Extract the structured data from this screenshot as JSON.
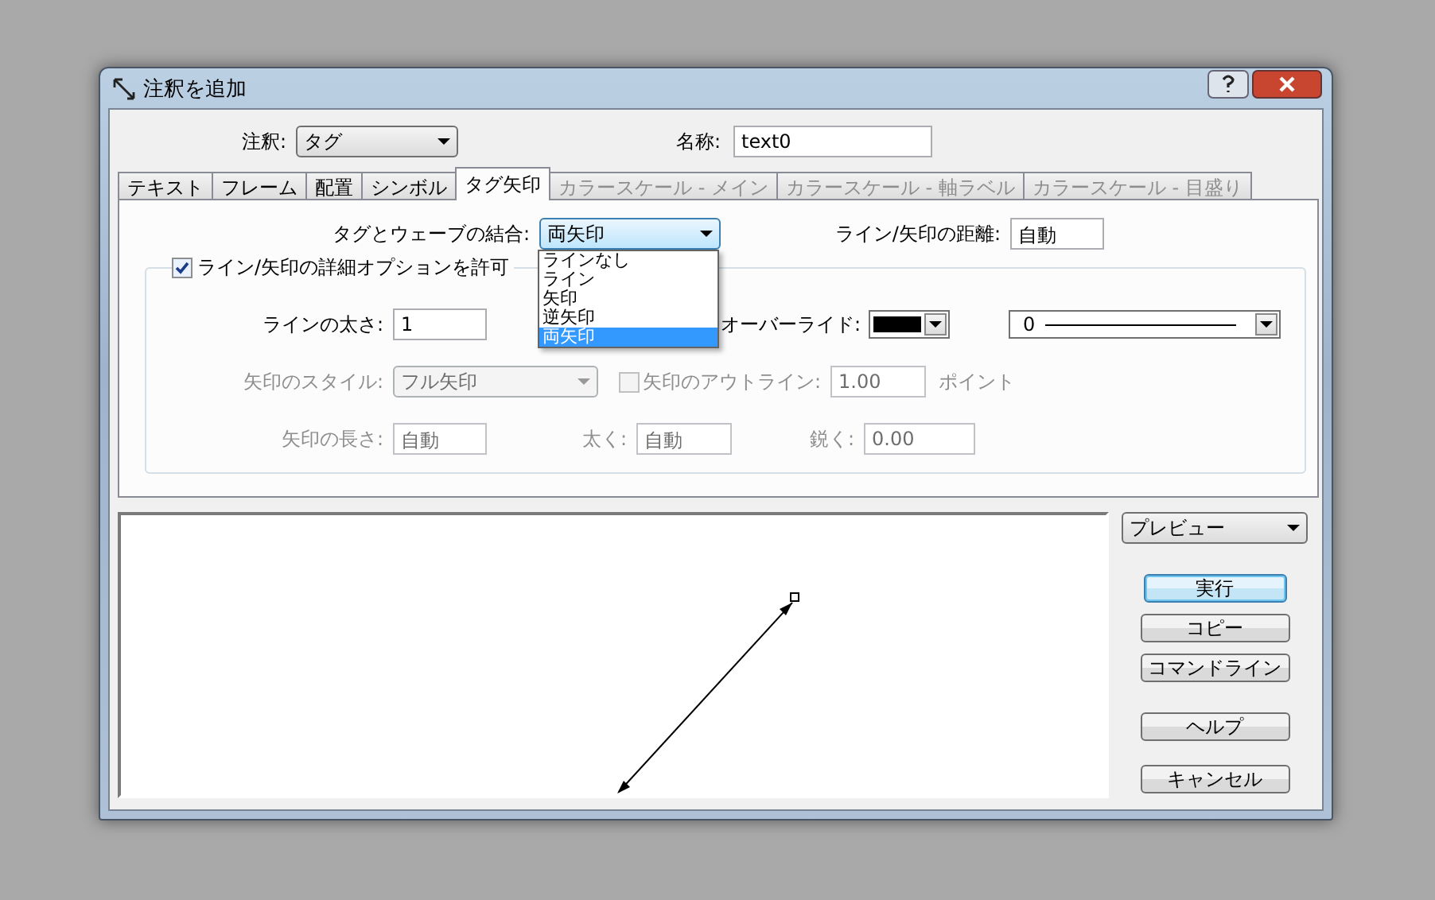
{
  "window": {
    "title": "注釈を追加"
  },
  "annotation": {
    "label": "注釈:",
    "value": "タグ"
  },
  "name": {
    "label": "名称:",
    "value": "text0"
  },
  "tabs": [
    {
      "label": "テキスト",
      "selected": false,
      "disabled": false
    },
    {
      "label": "フレーム",
      "selected": false,
      "disabled": false
    },
    {
      "label": "配置",
      "selected": false,
      "disabled": false
    },
    {
      "label": "シンボル",
      "selected": false,
      "disabled": false
    },
    {
      "label": "タグ矢印",
      "selected": true,
      "disabled": false
    },
    {
      "label": "カラースケール - メイン",
      "selected": false,
      "disabled": true
    },
    {
      "label": "カラースケール - 軸ラベル",
      "selected": false,
      "disabled": true
    },
    {
      "label": "カラースケール - 目盛り",
      "selected": false,
      "disabled": true
    }
  ],
  "join": {
    "label": "タグとウェーブの結合:",
    "value": "両矢印",
    "expanded": true,
    "options": [
      {
        "label": "ラインなし",
        "selected": false
      },
      {
        "label": "ライン",
        "selected": false
      },
      {
        "label": "矢印",
        "selected": false
      },
      {
        "label": "逆矢印",
        "selected": false
      },
      {
        "label": "両矢印",
        "selected": true
      }
    ]
  },
  "distance": {
    "label": "ライン/矢印の距離:",
    "value": "自動"
  },
  "advanced": {
    "label": "ライン/矢印の詳細オプションを許可",
    "checked": true
  },
  "line_width": {
    "label": "ラインの太さ:",
    "value": "1"
  },
  "override": {
    "label": "オーバーライド:",
    "line_style": "0"
  },
  "arrow_style": {
    "label": "矢印のスタイル:",
    "value": "フル矢印",
    "disabled": true
  },
  "outline": {
    "label": "矢印のアウトライン:",
    "checked": false,
    "disabled": true,
    "value": "1.00",
    "unit": "ポイント"
  },
  "arrow_length": {
    "label": "矢印の長さ:",
    "value": "自動",
    "disabled": true
  },
  "fat": {
    "label": "太く:",
    "value": "自動",
    "disabled": true
  },
  "sharp": {
    "label": "鋭く:",
    "value": "0.00",
    "disabled": true
  },
  "preview_mode": "プレビュー",
  "button_groups": [
    [
      {
        "label": "実行",
        "default": true
      },
      {
        "label": "コピー",
        "default": false
      },
      {
        "label": "コマンドライン",
        "default": false
      }
    ],
    [
      {
        "label": "ヘルプ",
        "default": false
      }
    ],
    [
      {
        "label": "キャンセル",
        "default": false
      }
    ]
  ]
}
